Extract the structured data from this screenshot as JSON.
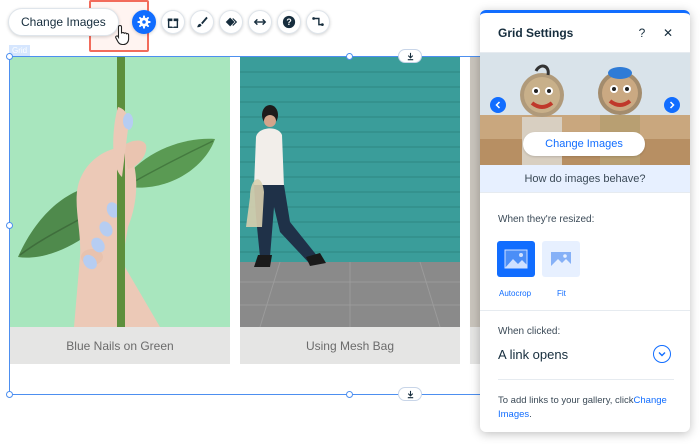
{
  "toolbar": {
    "change_images_label": "Change Images",
    "icons": [
      "settings-icon",
      "gift-icon",
      "brush-icon",
      "animation-icon",
      "stretch-icon",
      "help-icon",
      "connect-icon"
    ]
  },
  "grid": {
    "tag": "Grid",
    "items": [
      {
        "caption": "Blue Nails on Green"
      },
      {
        "caption": "Using Mesh Bag"
      }
    ]
  },
  "panel": {
    "title": "Grid Settings",
    "help": "?",
    "close": "✕",
    "change_images_label": "Change Images",
    "behave_label": "How do images behave?",
    "resized_label": "When they're resized:",
    "options": [
      "Autocrop",
      "Fit"
    ],
    "clicked_label": "When clicked:",
    "clicked_value": "A link opens",
    "note_text": "To add links to your gallery, click",
    "note_link": "Change Images",
    "note_end": "."
  },
  "colors": {
    "accent": "#116dff",
    "highlight": "#f26b5b",
    "selection": "#4d8ff0"
  }
}
